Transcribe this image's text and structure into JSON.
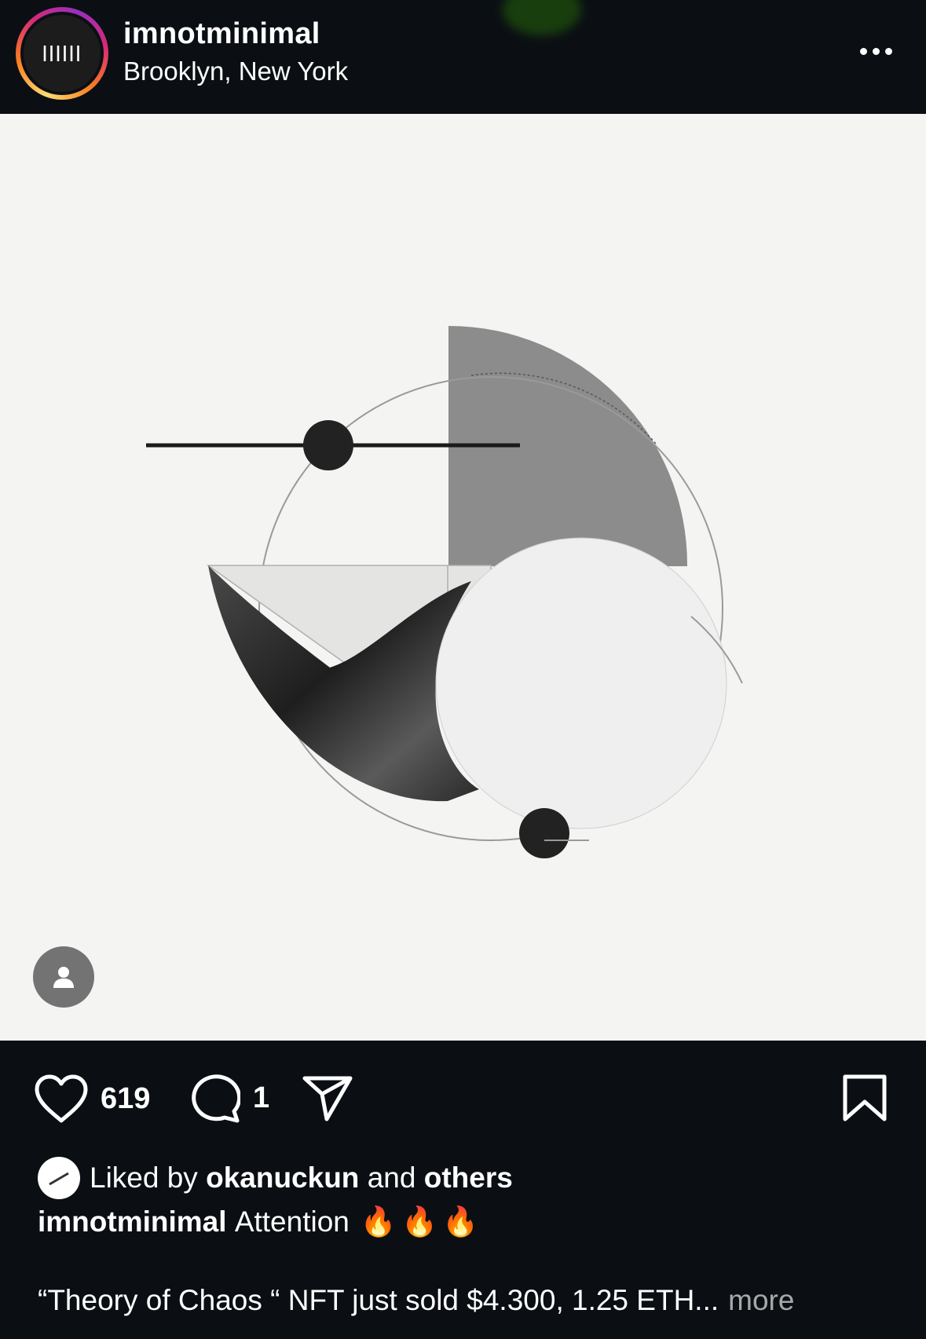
{
  "header": {
    "username": "imnotminimal",
    "location": "Brooklyn, New York",
    "avatar_mark": "||||||",
    "more_icon": "ellipsis-icon"
  },
  "post": {
    "image_description_icon": "geometric-artwork",
    "tag_icon": "person-icon"
  },
  "actions": {
    "like_icon": "heart-icon",
    "like_count": "619",
    "comment_icon": "comment-icon",
    "comment_count": "1",
    "share_icon": "send-icon",
    "save_icon": "bookmark-icon"
  },
  "likes": {
    "prefix": "Liked by",
    "user": "okanuckun",
    "conjunction": "and",
    "others": "others"
  },
  "caption": {
    "username": "imnotminimal",
    "text": "Attention",
    "emoji": "🔥🔥🔥",
    "line2": "“Theory of Chaos “ NFT just sold $4.300, 1.25 ETH...",
    "more_label": "more"
  },
  "colors": {
    "background": "#0b0f14",
    "image_background": "#f4f4f3",
    "muted_text": "#a8a8a8"
  }
}
